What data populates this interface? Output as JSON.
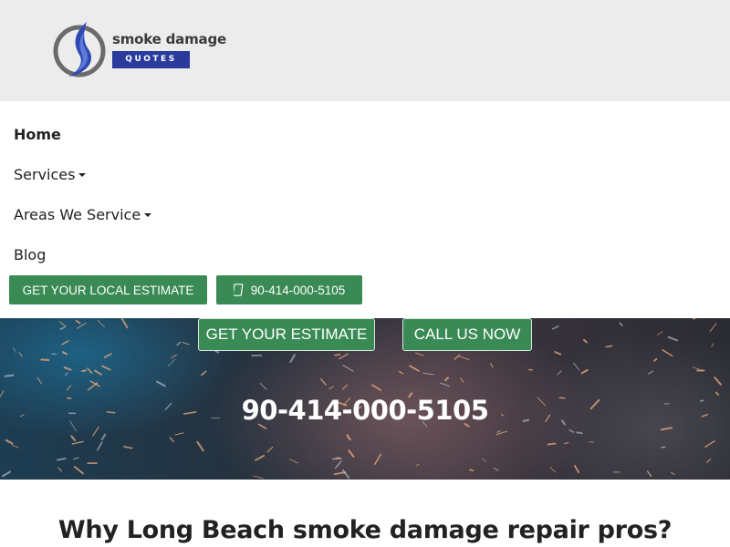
{
  "header": {
    "logo": {
      "text": "smoke damage",
      "badge": "QUOTES"
    }
  },
  "nav": {
    "items": [
      {
        "label": "Home",
        "active": true,
        "dropdown": false
      },
      {
        "label": "Services",
        "active": false,
        "dropdown": true
      },
      {
        "label": "Areas We Service",
        "active": false,
        "dropdown": true
      },
      {
        "label": "Blog",
        "active": false,
        "dropdown": false
      }
    ],
    "estimate_button": "GET YOUR LOCAL ESTIMATE",
    "phone_button": "90-414-000-5105"
  },
  "hero": {
    "estimate_button": "GET YOUR ESTIMATE",
    "call_button": "CALL US NOW",
    "phone": "90-414-000-5105"
  },
  "main": {
    "title": "Why Long Beach smoke damage repair pros?"
  },
  "colors": {
    "header_bg": "#ececec",
    "brand_blue": "#2a3b9c",
    "button_green": "#3a8a55"
  },
  "icons": {
    "logo": "flame-logo-icon",
    "phone": "phone-icon",
    "dropdown": "caret-down-icon"
  }
}
